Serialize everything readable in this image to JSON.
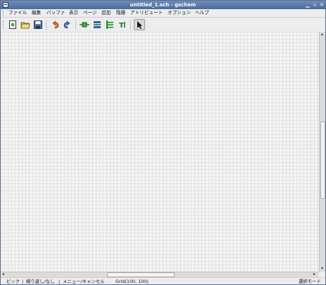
{
  "window": {
    "title": "untitled_1.sch - gschem"
  },
  "menu": [
    "ファイル",
    "編集",
    "バッファ",
    "表示",
    "ページ",
    "追加",
    "階層",
    "アトリビュート",
    "オプション",
    "ヘルプ"
  ],
  "toolbar": {
    "icons": [
      "new-page-icon",
      "open-folder-icon",
      "save-icon",
      "undo-icon",
      "redo-icon",
      "add-component-icon",
      "add-net-icon",
      "add-bus-icon",
      "add-text-icon",
      "select-arrow-icon"
    ]
  },
  "statusbar": {
    "left_mode": "ピック",
    "repeat": "繰り返し/なし",
    "menu_cancel": "メニュー/キャンセル",
    "grid": "Grid(100, 100)",
    "right_mode": "選択モード"
  },
  "colors": {
    "titlebar": "#5a78a8",
    "canvas": "#f4f4f4",
    "grid": "#e2e2e2"
  }
}
